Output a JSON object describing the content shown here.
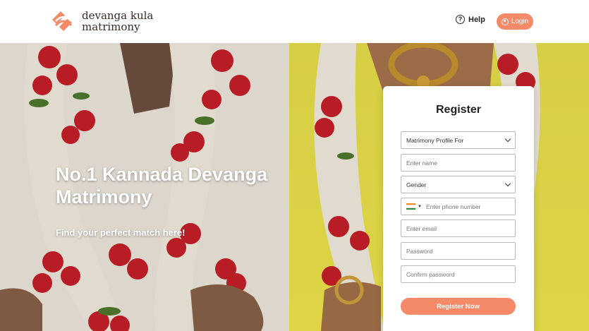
{
  "brand": {
    "line1": "devanga kula",
    "line2": "matrimony",
    "accent": "#f58a68"
  },
  "nav": {
    "help_label": "Help",
    "help_icon": "question-circle-icon",
    "login_label": "Login",
    "login_icon": "user-circle-icon"
  },
  "hero": {
    "title": "No.1 Kannada Devanga Matrimony",
    "subtitle": "Find your perfect match here!"
  },
  "register": {
    "heading": "Register",
    "profile_for": "Matrimony Profile For",
    "name_placeholder": "Enter name",
    "gender": "Gender",
    "phone_placeholder": "Enter phone number",
    "email_placeholder": "Enter email",
    "password_placeholder": "Password",
    "confirm_placeholder": "Confirm password",
    "submit_label": "Register Now",
    "country_flag_icon": "india-flag-icon"
  }
}
